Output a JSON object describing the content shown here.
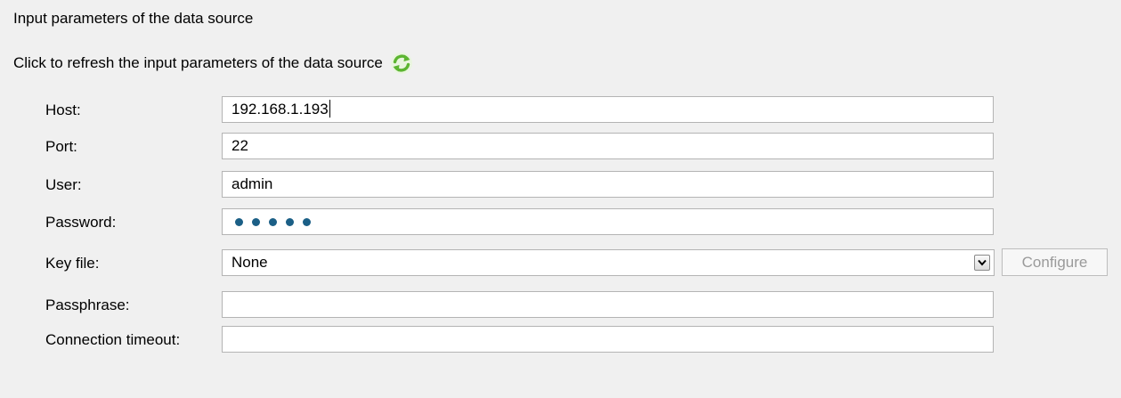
{
  "section_title": "Input parameters of the data source",
  "refresh": {
    "text": "Click to refresh the input parameters of the data source",
    "icon": "refresh-icon",
    "icon_color": "#5cb531"
  },
  "fields": {
    "host": {
      "label": "Host:",
      "value": "192.168.1.193"
    },
    "port": {
      "label": "Port:",
      "value": "22"
    },
    "user": {
      "label": "User:",
      "value": "admin"
    },
    "password": {
      "label": "Password:",
      "masked_length": 5,
      "dot_color": "#1b5f86"
    },
    "key_file": {
      "label": "Key file:",
      "selected": "None",
      "configure_label": "Configure"
    },
    "passphrase": {
      "label": "Passphrase:",
      "value": ""
    },
    "connection_timeout": {
      "label": "Connection timeout:",
      "value": ""
    }
  }
}
